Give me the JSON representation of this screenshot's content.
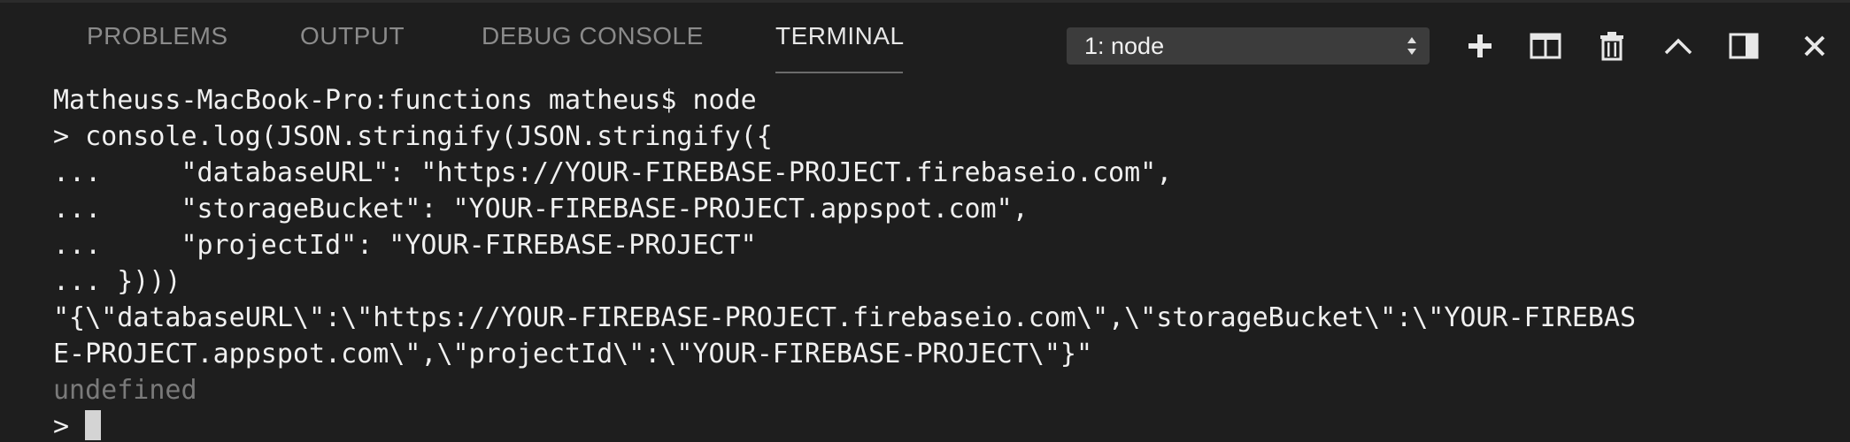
{
  "tabs": [
    {
      "label": "PROBLEMS",
      "active": false
    },
    {
      "label": "OUTPUT",
      "active": false
    },
    {
      "label": "DEBUG CONSOLE",
      "active": false
    },
    {
      "label": "TERMINAL",
      "active": true
    }
  ],
  "terminal_select": {
    "value": "1: node"
  },
  "actions": [
    {
      "name": "new-terminal",
      "icon": "plus-icon"
    },
    {
      "name": "split-terminal",
      "icon": "split-icon"
    },
    {
      "name": "kill-terminal",
      "icon": "trash-icon"
    },
    {
      "name": "maximize-panel",
      "icon": "chevron-up-icon"
    },
    {
      "name": "toggle-panel-position",
      "icon": "panel-right-icon"
    },
    {
      "name": "close-panel",
      "icon": "close-icon"
    }
  ],
  "terminal": {
    "lines": [
      "Matheuss-MacBook-Pro:functions matheus$ node",
      "> console.log(JSON.stringify(JSON.stringify({",
      "...     \"databaseURL\": \"https://YOUR-FIREBASE-PROJECT.firebaseio.com\",",
      "...     \"storageBucket\": \"YOUR-FIREBASE-PROJECT.appspot.com\",",
      "...     \"projectId\": \"YOUR-FIREBASE-PROJECT\"",
      "... })))",
      "\"{\\\"databaseURL\\\":\\\"https://YOUR-FIREBASE-PROJECT.firebaseio.com\\\",\\\"storageBucket\\\":\\\"YOUR-FIREBAS",
      "E-PROJECT.appspot.com\\\",\\\"projectId\\\":\\\"YOUR-FIREBASE-PROJECT\\\"}\""
    ],
    "undefined_line": "undefined",
    "prompt": "> "
  },
  "colors": {
    "background": "#1e1e1e",
    "tab_inactive": "#8b8b8b",
    "tab_active": "#e7e7e7",
    "dim_text": "#7a7a7a"
  }
}
